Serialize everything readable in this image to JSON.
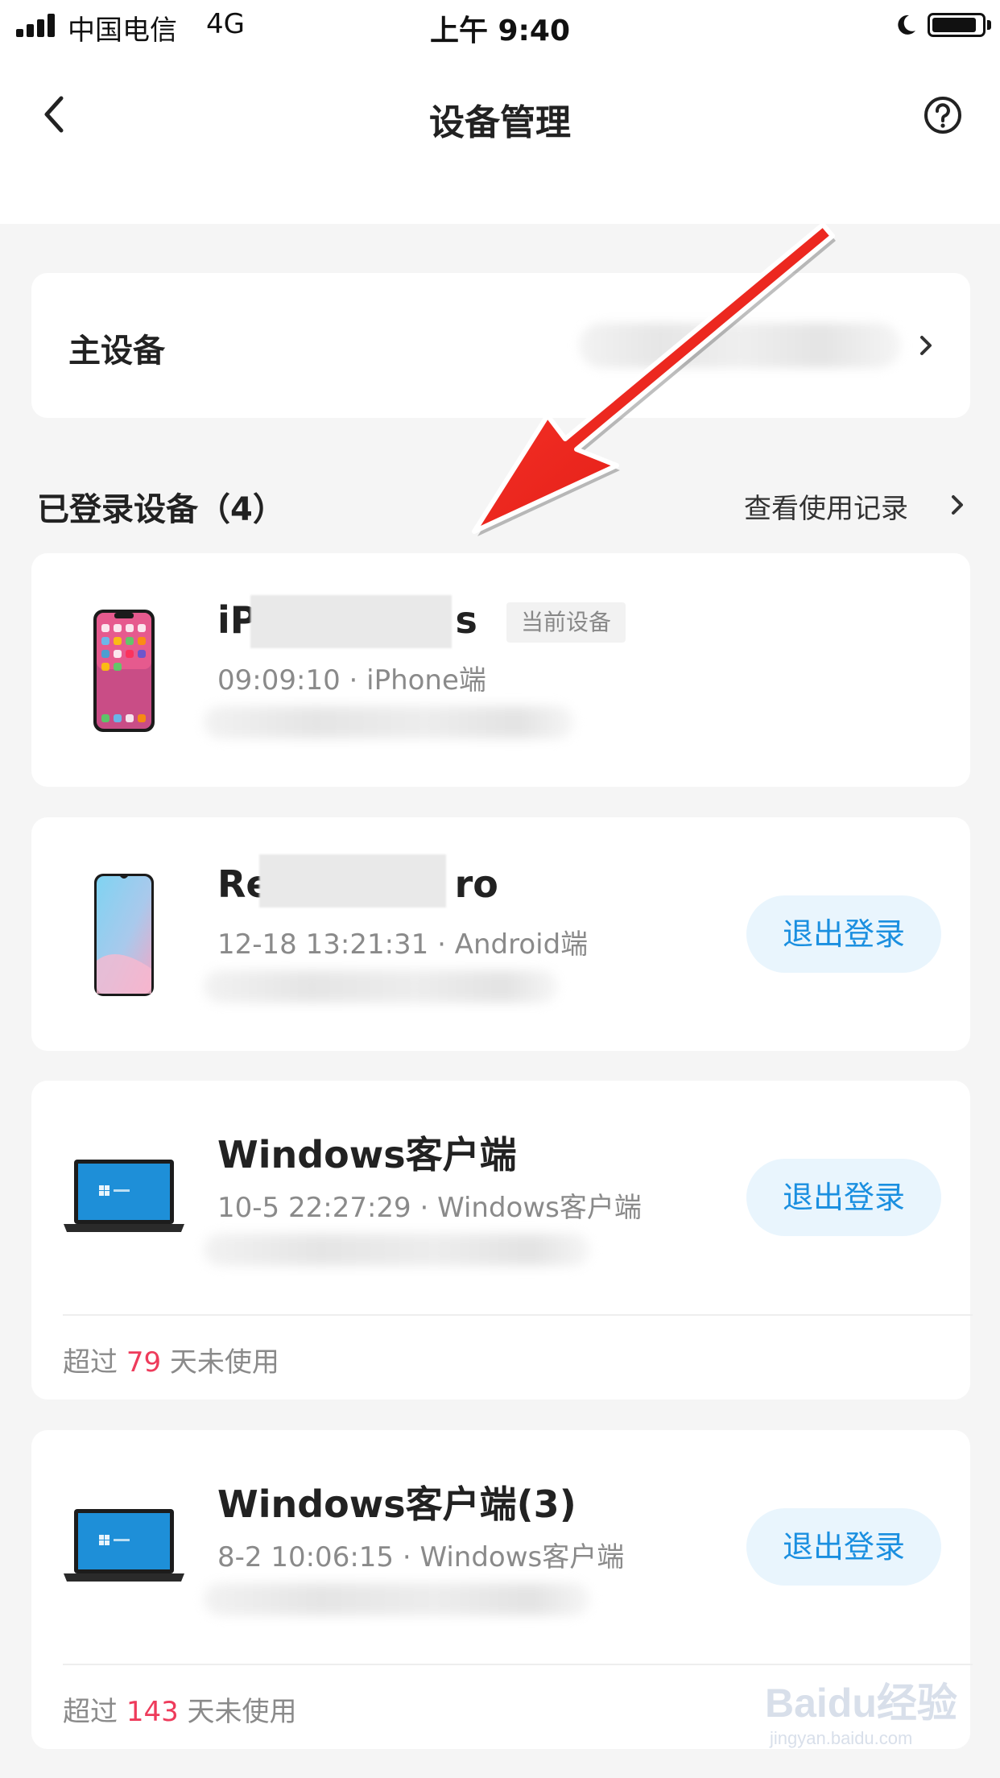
{
  "status_bar": {
    "carrier": "中国电信",
    "network": "4G",
    "time": "上午 9:40",
    "battery_level": 0.9
  },
  "nav": {
    "title": "设备管理",
    "back_icon": "chevron-left-icon",
    "help_icon": "question-circle-icon"
  },
  "primary_device": {
    "label": "主设备",
    "chevron_icon": "chevron-right-icon"
  },
  "logged_in": {
    "header": "已登录设备（4）",
    "history_link": "查看使用记录"
  },
  "devices": [
    {
      "icon": "iphone-icon",
      "name_prefix": "iP",
      "name_suffix": "s",
      "badge": "当前设备",
      "meta": "09:09:10 · iPhone端"
    },
    {
      "icon": "android-phone-icon",
      "name_prefix": "Re",
      "name_suffix": "ro",
      "meta": "12-18 13:21:31 · Android端",
      "action": "退出登录"
    },
    {
      "icon": "laptop-icon",
      "name": "Windows客户端",
      "meta": "10-5 22:27:29 · Windows客户端",
      "action": "退出登录",
      "unused_prefix": "超过",
      "unused_days": "79",
      "unused_suffix": "天未使用"
    },
    {
      "icon": "laptop-icon",
      "name": "Windows客户端(3)",
      "meta": "8-2 10:06:15 · Windows客户端",
      "action": "退出登录",
      "unused_prefix": "超过",
      "unused_days": "143",
      "unused_suffix": "天未使用"
    }
  ],
  "colors": {
    "accent_blue": "#1a8fe0",
    "button_bg": "#e9f5fd",
    "highlight_red": "#ee3b5b",
    "annotation_arrow": "#e8231b",
    "page_bg": "#f5f5f5"
  },
  "watermark": {
    "brand": "Baidu经验",
    "url": "jingyan.baidu.com"
  }
}
